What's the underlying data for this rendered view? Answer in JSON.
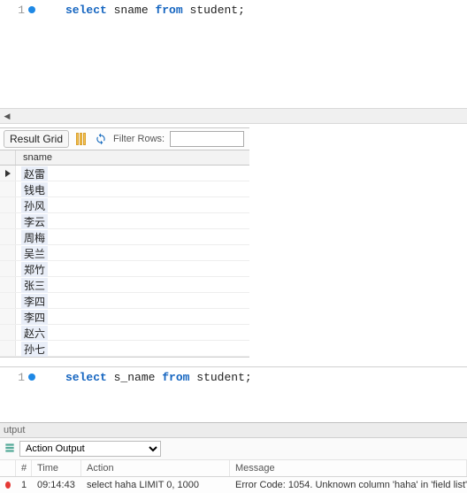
{
  "editor1": {
    "line_number": "1",
    "kw_select": "select",
    "ident1": "sname",
    "kw_from": "from",
    "ident2": "student",
    "semi": ";"
  },
  "result_toolbar": {
    "result_grid_label": "Result Grid",
    "filter_label": "Filter Rows:",
    "filter_value": ""
  },
  "grid": {
    "header": "sname",
    "rows": [
      "赵雷",
      "钱电",
      "孙风",
      "李云",
      "周梅",
      "吴兰",
      "郑竹",
      "张三",
      "李四",
      "李四",
      "赵六",
      "孙七"
    ]
  },
  "editor2": {
    "line_number": "1",
    "kw_select": "select",
    "ident1": "s_name",
    "kw_from": "from",
    "ident2": "student",
    "semi": ";"
  },
  "output": {
    "panel_title": "utput",
    "selector_value": "Action Output",
    "headers": {
      "num": "#",
      "time": "Time",
      "action": "Action",
      "message": "Message"
    },
    "row": {
      "num": "1",
      "time": "09:14:43",
      "action": "select haha LIMIT 0, 1000",
      "message": "Error Code: 1054. Unknown column 'haha' in 'field list'"
    }
  }
}
